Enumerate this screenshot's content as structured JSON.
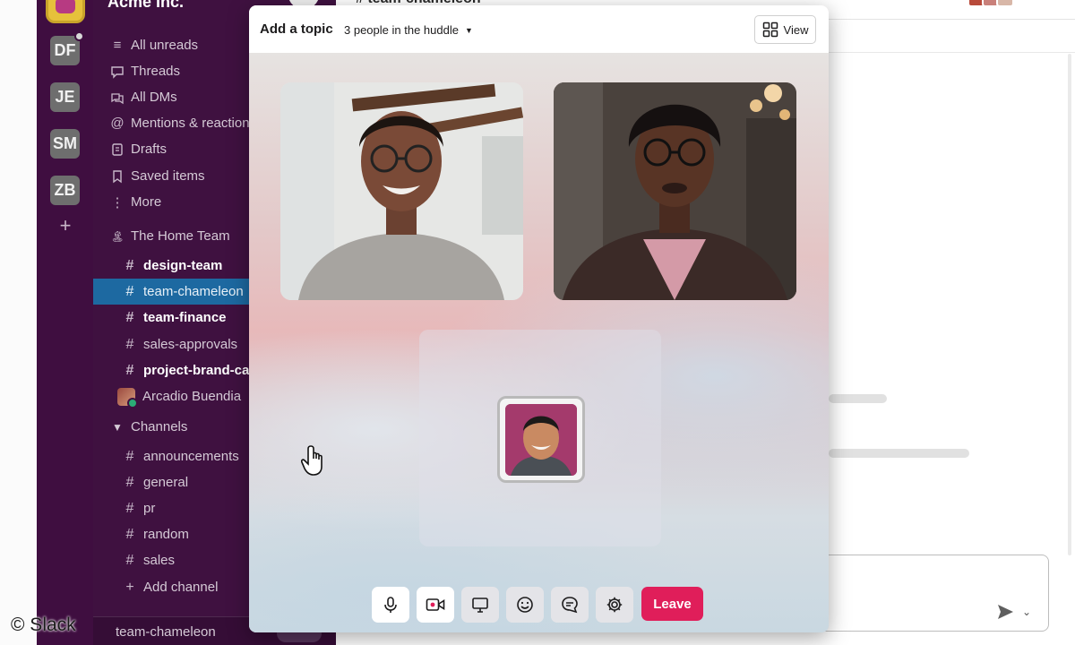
{
  "workspace": {
    "name": "Acme Inc.",
    "workspaces": [
      "DF",
      "JE",
      "SM",
      "ZB"
    ]
  },
  "sidebar": {
    "top_items": [
      {
        "icon": "all-unreads-icon",
        "label": "All unreads"
      },
      {
        "icon": "threads-icon",
        "label": "Threads"
      },
      {
        "icon": "dms-icon",
        "label": "All DMs"
      },
      {
        "icon": "mentions-icon",
        "label": "Mentions & reactions"
      },
      {
        "icon": "drafts-icon",
        "label": "Drafts"
      },
      {
        "icon": "bookmark-icon",
        "label": "Saved items"
      },
      {
        "icon": "more-icon",
        "label": "More"
      }
    ],
    "team_section": "The Home Team",
    "team_channels": [
      {
        "label": "design-team",
        "bold": true
      },
      {
        "label": "team-chameleon",
        "active": true
      },
      {
        "label": "team-finance",
        "bold": true
      },
      {
        "label": "sales-approvals"
      },
      {
        "label": "project-brand-campaign",
        "bold": true
      }
    ],
    "dm": "Arcadio Buendia",
    "channels_section": "Channels",
    "channels": [
      "announcements",
      "general",
      "pr",
      "random",
      "sales"
    ],
    "add_channel": "Add channel",
    "footer_label": "team-chameleon"
  },
  "main": {
    "channel_title": "# team-chameleon"
  },
  "huddle": {
    "topic_label": "Add a topic",
    "people_label": "3 people in the huddle",
    "view_label": "View",
    "leave_label": "Leave",
    "controls": [
      "microphone-icon",
      "video-icon",
      "screen-share-icon",
      "emoji-icon",
      "chat-icon",
      "settings-icon"
    ]
  },
  "watermark": "© Slack",
  "colors": {
    "rail": "#3f0e40",
    "sidebar": "#3f1140",
    "active_channel": "#1d69a1",
    "leave": "#e01e5a"
  }
}
